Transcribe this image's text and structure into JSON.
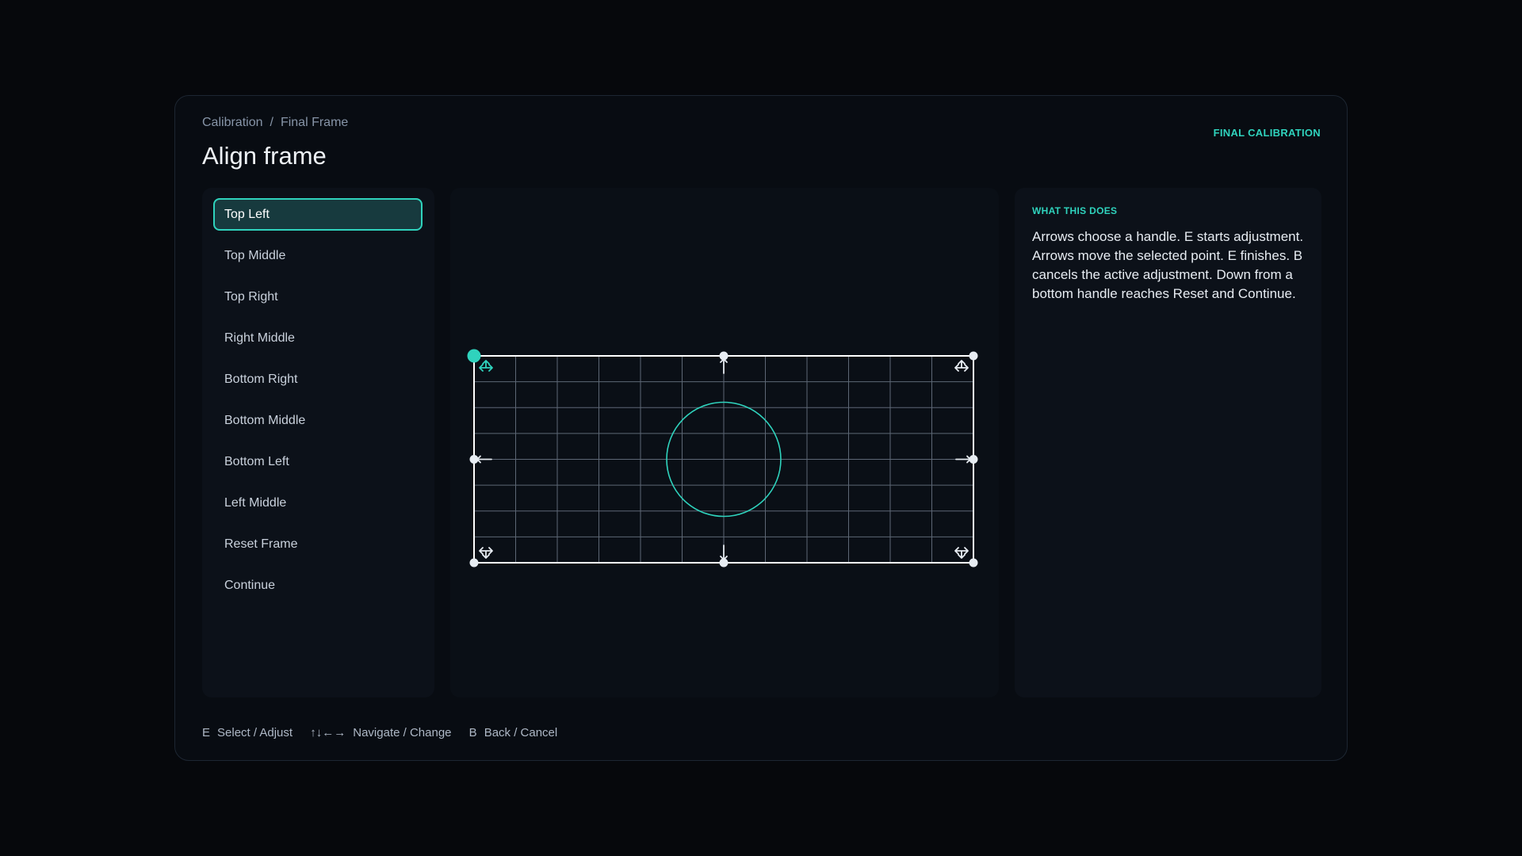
{
  "breadcrumb": {
    "parent": "Calibration",
    "separator": "/",
    "current": "Final Frame"
  },
  "title": "Align frame",
  "status_tag": "FINAL CALIBRATION",
  "menu": {
    "selected": "Top Left",
    "items": [
      {
        "label": "Top Left"
      },
      {
        "label": "Top Middle"
      },
      {
        "label": "Top Right"
      },
      {
        "label": "Right Middle"
      },
      {
        "label": "Bottom Right"
      },
      {
        "label": "Bottom Middle"
      },
      {
        "label": "Bottom Left"
      },
      {
        "label": "Left Middle"
      },
      {
        "label": "Reset Frame"
      },
      {
        "label": "Continue"
      }
    ]
  },
  "frame": {
    "grid_columns": 12,
    "grid_rows": 8,
    "active_handle": "top-left",
    "handles": [
      "top-left",
      "top-middle",
      "top-right",
      "right-middle",
      "bottom-right",
      "bottom-middle",
      "bottom-left",
      "left-middle"
    ]
  },
  "info": {
    "heading": "WHAT THIS DOES",
    "body": "Arrows choose a handle. E starts adjustment. Arrows move the selected point. E finishes. B cancels the active adjustment. Down from a bottom handle reaches Reset and Continue."
  },
  "hints": [
    {
      "key": "E",
      "label": "Select / Adjust"
    },
    {
      "key": "↑↓←→",
      "label": "Navigate / Change"
    },
    {
      "key": "B",
      "label": "Back / Cancel"
    }
  ],
  "colors": {
    "accent": "#2fd3bd",
    "background": "#06080c",
    "panel": "#080c12",
    "card": "#0c1119",
    "grid_line": "#5d6775",
    "frame_line": "#ffffff",
    "handle": "#e7ecf2"
  },
  "icons": {
    "corner_handle": "move-cross-icon",
    "edge_handle": "arrow-icon"
  }
}
